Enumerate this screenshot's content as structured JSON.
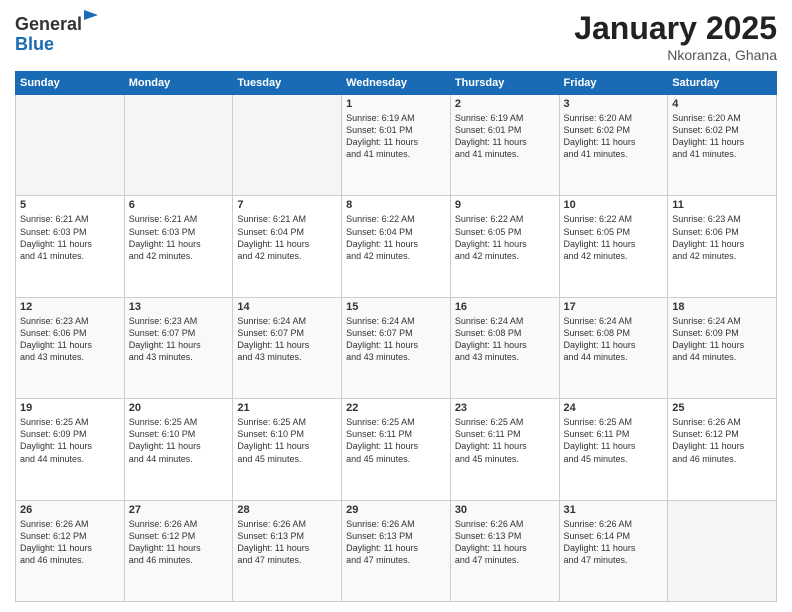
{
  "header": {
    "logo_general": "General",
    "logo_blue": "Blue",
    "title": "January 2025",
    "location": "Nkoranza, Ghana"
  },
  "weekdays": [
    "Sunday",
    "Monday",
    "Tuesday",
    "Wednesday",
    "Thursday",
    "Friday",
    "Saturday"
  ],
  "weeks": [
    [
      {
        "day": "",
        "info": ""
      },
      {
        "day": "",
        "info": ""
      },
      {
        "day": "",
        "info": ""
      },
      {
        "day": "1",
        "info": "Sunrise: 6:19 AM\nSunset: 6:01 PM\nDaylight: 11 hours\nand 41 minutes."
      },
      {
        "day": "2",
        "info": "Sunrise: 6:19 AM\nSunset: 6:01 PM\nDaylight: 11 hours\nand 41 minutes."
      },
      {
        "day": "3",
        "info": "Sunrise: 6:20 AM\nSunset: 6:02 PM\nDaylight: 11 hours\nand 41 minutes."
      },
      {
        "day": "4",
        "info": "Sunrise: 6:20 AM\nSunset: 6:02 PM\nDaylight: 11 hours\nand 41 minutes."
      }
    ],
    [
      {
        "day": "5",
        "info": "Sunrise: 6:21 AM\nSunset: 6:03 PM\nDaylight: 11 hours\nand 41 minutes."
      },
      {
        "day": "6",
        "info": "Sunrise: 6:21 AM\nSunset: 6:03 PM\nDaylight: 11 hours\nand 42 minutes."
      },
      {
        "day": "7",
        "info": "Sunrise: 6:21 AM\nSunset: 6:04 PM\nDaylight: 11 hours\nand 42 minutes."
      },
      {
        "day": "8",
        "info": "Sunrise: 6:22 AM\nSunset: 6:04 PM\nDaylight: 11 hours\nand 42 minutes."
      },
      {
        "day": "9",
        "info": "Sunrise: 6:22 AM\nSunset: 6:05 PM\nDaylight: 11 hours\nand 42 minutes."
      },
      {
        "day": "10",
        "info": "Sunrise: 6:22 AM\nSunset: 6:05 PM\nDaylight: 11 hours\nand 42 minutes."
      },
      {
        "day": "11",
        "info": "Sunrise: 6:23 AM\nSunset: 6:06 PM\nDaylight: 11 hours\nand 42 minutes."
      }
    ],
    [
      {
        "day": "12",
        "info": "Sunrise: 6:23 AM\nSunset: 6:06 PM\nDaylight: 11 hours\nand 43 minutes."
      },
      {
        "day": "13",
        "info": "Sunrise: 6:23 AM\nSunset: 6:07 PM\nDaylight: 11 hours\nand 43 minutes."
      },
      {
        "day": "14",
        "info": "Sunrise: 6:24 AM\nSunset: 6:07 PM\nDaylight: 11 hours\nand 43 minutes."
      },
      {
        "day": "15",
        "info": "Sunrise: 6:24 AM\nSunset: 6:07 PM\nDaylight: 11 hours\nand 43 minutes."
      },
      {
        "day": "16",
        "info": "Sunrise: 6:24 AM\nSunset: 6:08 PM\nDaylight: 11 hours\nand 43 minutes."
      },
      {
        "day": "17",
        "info": "Sunrise: 6:24 AM\nSunset: 6:08 PM\nDaylight: 11 hours\nand 44 minutes."
      },
      {
        "day": "18",
        "info": "Sunrise: 6:24 AM\nSunset: 6:09 PM\nDaylight: 11 hours\nand 44 minutes."
      }
    ],
    [
      {
        "day": "19",
        "info": "Sunrise: 6:25 AM\nSunset: 6:09 PM\nDaylight: 11 hours\nand 44 minutes."
      },
      {
        "day": "20",
        "info": "Sunrise: 6:25 AM\nSunset: 6:10 PM\nDaylight: 11 hours\nand 44 minutes."
      },
      {
        "day": "21",
        "info": "Sunrise: 6:25 AM\nSunset: 6:10 PM\nDaylight: 11 hours\nand 45 minutes."
      },
      {
        "day": "22",
        "info": "Sunrise: 6:25 AM\nSunset: 6:11 PM\nDaylight: 11 hours\nand 45 minutes."
      },
      {
        "day": "23",
        "info": "Sunrise: 6:25 AM\nSunset: 6:11 PM\nDaylight: 11 hours\nand 45 minutes."
      },
      {
        "day": "24",
        "info": "Sunrise: 6:25 AM\nSunset: 6:11 PM\nDaylight: 11 hours\nand 45 minutes."
      },
      {
        "day": "25",
        "info": "Sunrise: 6:26 AM\nSunset: 6:12 PM\nDaylight: 11 hours\nand 46 minutes."
      }
    ],
    [
      {
        "day": "26",
        "info": "Sunrise: 6:26 AM\nSunset: 6:12 PM\nDaylight: 11 hours\nand 46 minutes."
      },
      {
        "day": "27",
        "info": "Sunrise: 6:26 AM\nSunset: 6:12 PM\nDaylight: 11 hours\nand 46 minutes."
      },
      {
        "day": "28",
        "info": "Sunrise: 6:26 AM\nSunset: 6:13 PM\nDaylight: 11 hours\nand 47 minutes."
      },
      {
        "day": "29",
        "info": "Sunrise: 6:26 AM\nSunset: 6:13 PM\nDaylight: 11 hours\nand 47 minutes."
      },
      {
        "day": "30",
        "info": "Sunrise: 6:26 AM\nSunset: 6:13 PM\nDaylight: 11 hours\nand 47 minutes."
      },
      {
        "day": "31",
        "info": "Sunrise: 6:26 AM\nSunset: 6:14 PM\nDaylight: 11 hours\nand 47 minutes."
      },
      {
        "day": "",
        "info": ""
      }
    ]
  ]
}
